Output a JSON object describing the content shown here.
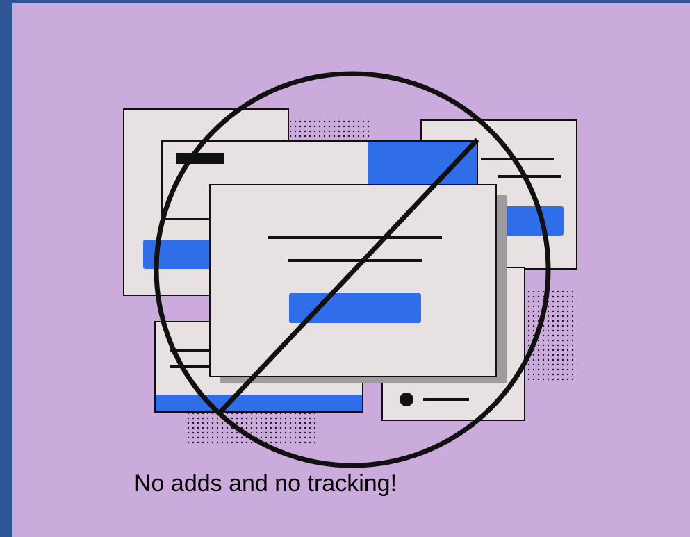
{
  "slide": {
    "caption": "No adds and no tracking!"
  },
  "colors": {
    "frame": "#2e5596",
    "background": "#cbaadc",
    "window": "#e8e1e1",
    "accent": "#2f6ee8",
    "ink": "#111111",
    "shadow": "#9f9a9d"
  },
  "icons": {
    "prohibition": "no-entry-circle-slash"
  }
}
